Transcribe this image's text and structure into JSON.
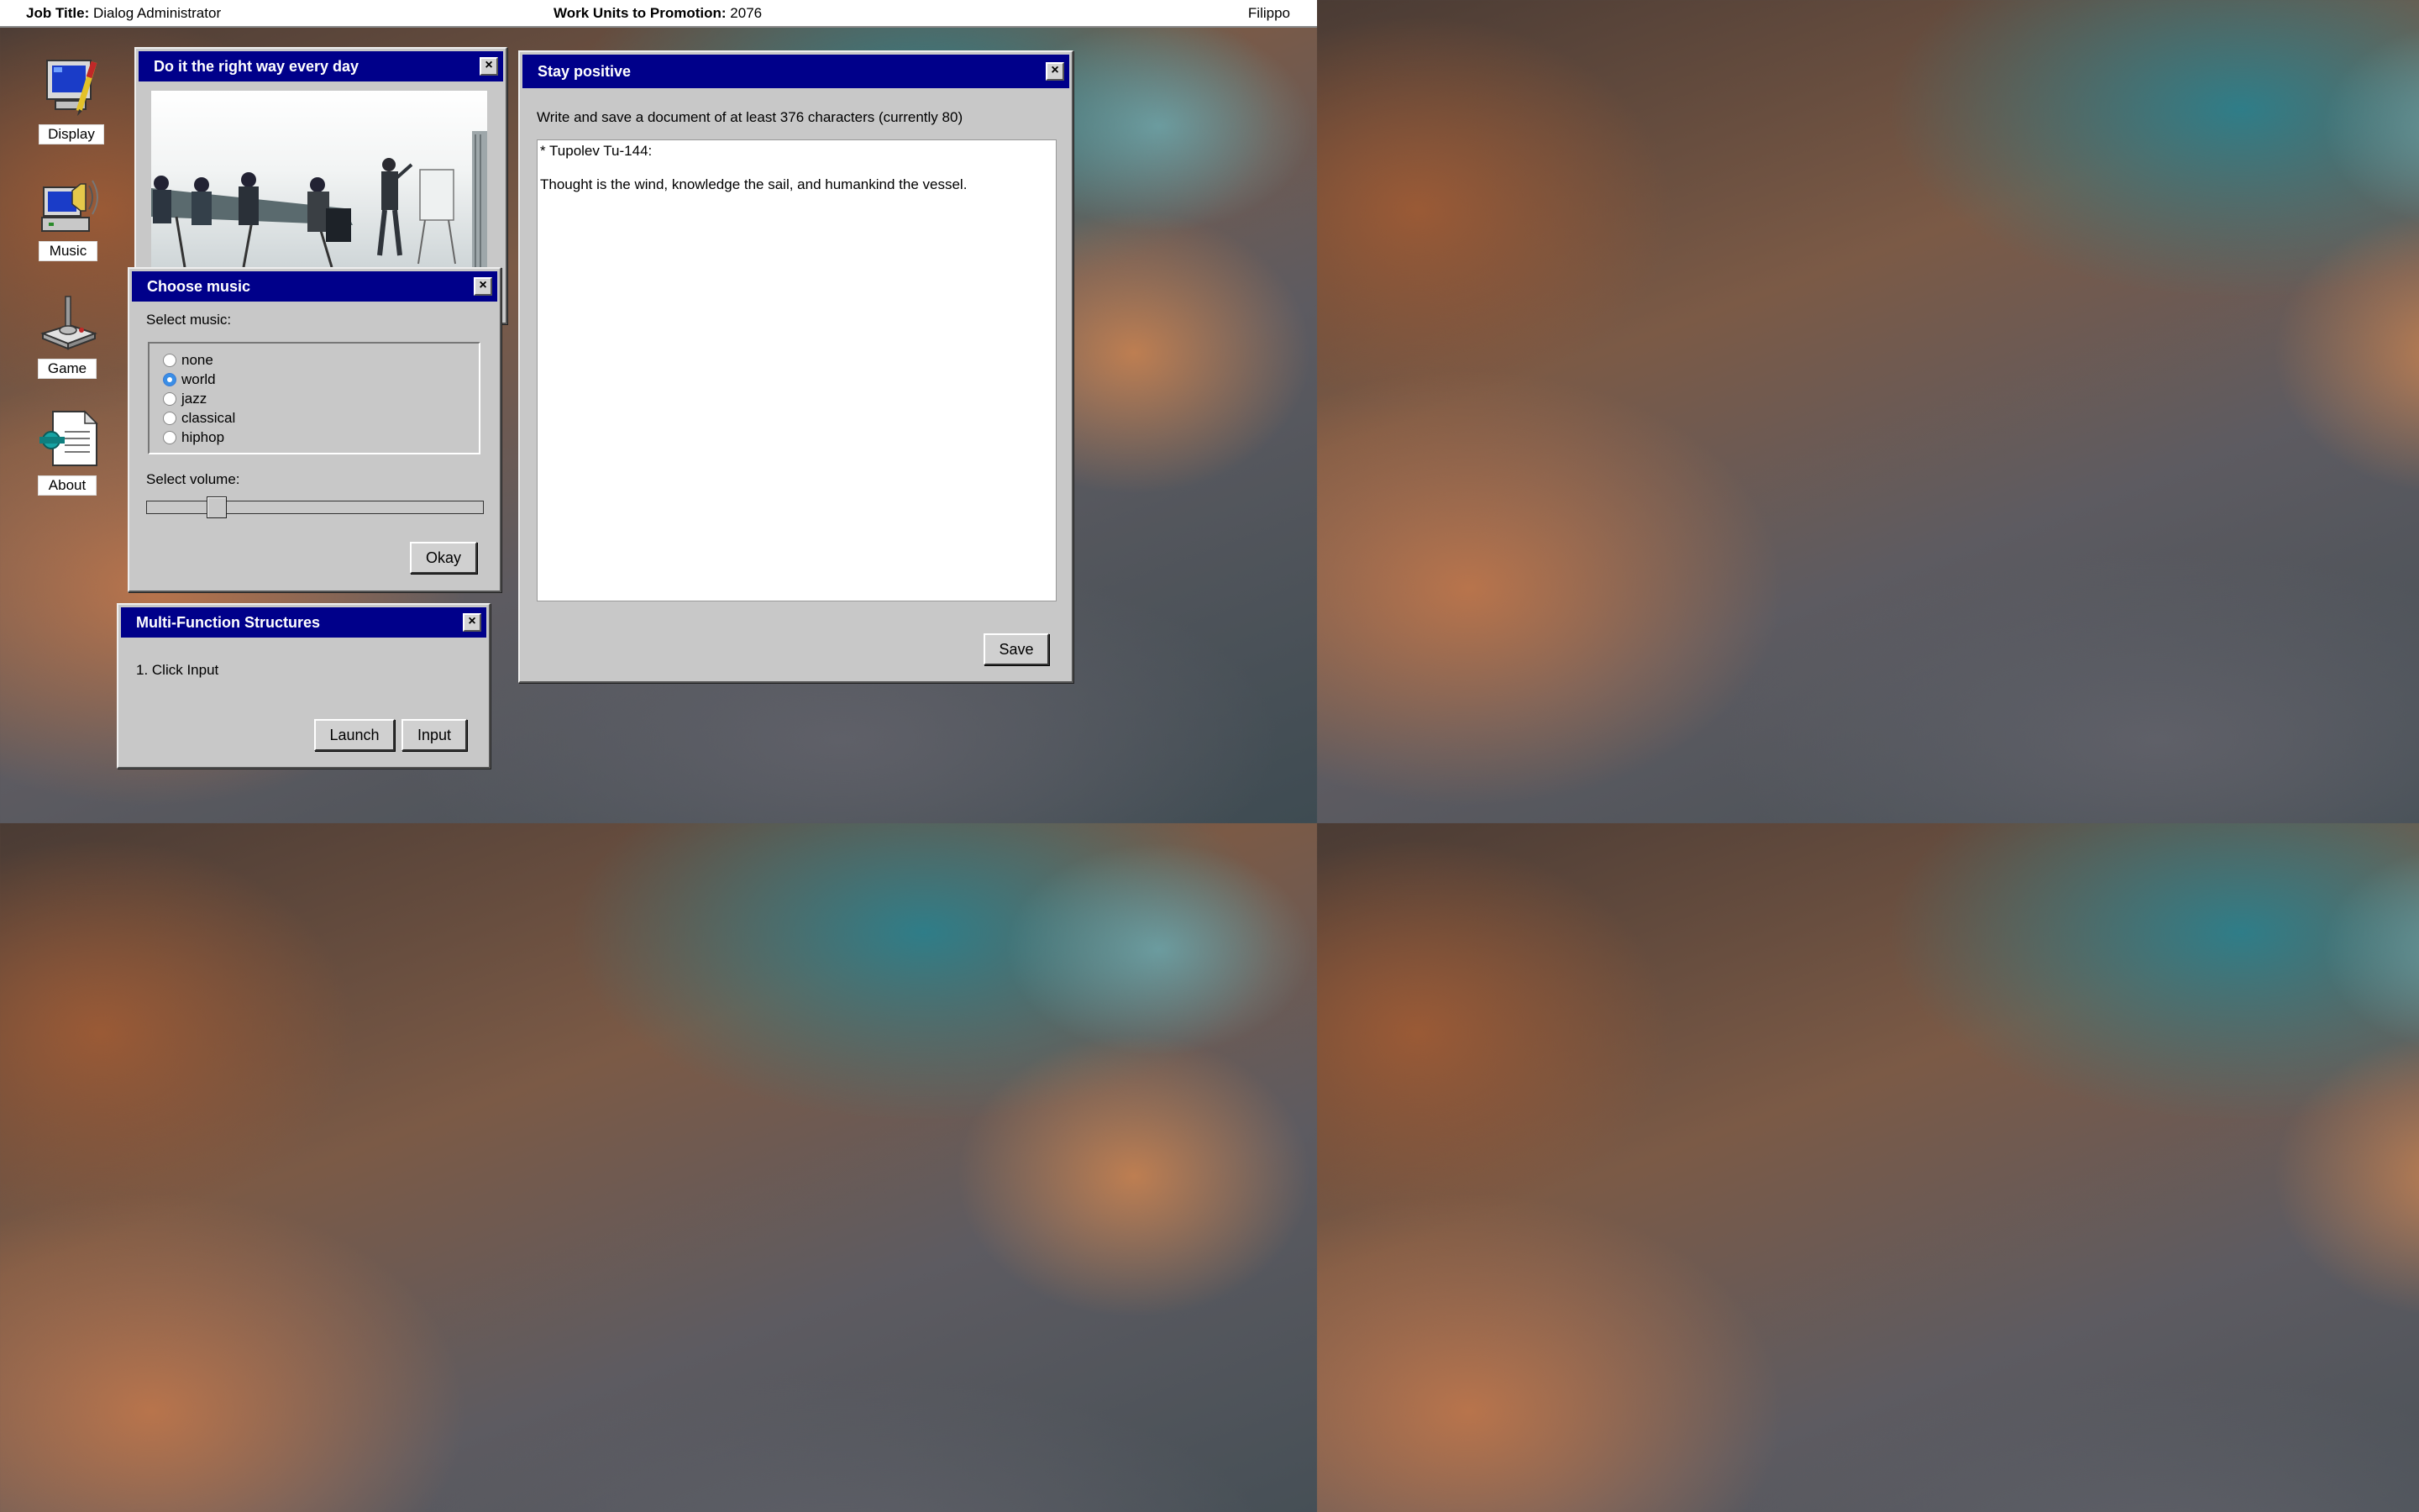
{
  "topbar": {
    "job_title_label": "Job Title:",
    "job_title_value": "Dialog Administrator",
    "promotion_label": "Work Units to Promotion:",
    "promotion_value": "2076",
    "user": "Filippo"
  },
  "desktop_icons": [
    {
      "label": "Display",
      "icon": "display-icon"
    },
    {
      "label": "Music",
      "icon": "music-icon"
    },
    {
      "label": "Game",
      "icon": "joystick-icon"
    },
    {
      "label": "About",
      "icon": "document-icon"
    }
  ],
  "photo_window": {
    "title": "Do it the right way every day",
    "close": "×"
  },
  "music_window": {
    "title": "Choose music",
    "close": "×",
    "select_music_label": "Select music:",
    "options": [
      "none",
      "world",
      "jazz",
      "classical",
      "hiphop"
    ],
    "selected": "world",
    "select_volume_label": "Select volume:",
    "volume_fraction": 0.19,
    "okay_label": "Okay"
  },
  "multi_window": {
    "title": "Multi-Function Structures",
    "close": "×",
    "instruction": "1. Click Input",
    "launch_label": "Launch",
    "input_label": "Input"
  },
  "editor_window": {
    "title": "Stay positive",
    "close": "×",
    "prompt": "Write and save a document of at least 376 characters (currently 80)",
    "content": "* Tupolev Tu-144:\n\nThought is the wind, knowledge the sail, and humankind the vessel.",
    "save_label": "Save"
  },
  "colors": {
    "titlebar": "#00008a",
    "window_bg": "#c8c8c8",
    "radio_checked": "#3a8ee6"
  }
}
